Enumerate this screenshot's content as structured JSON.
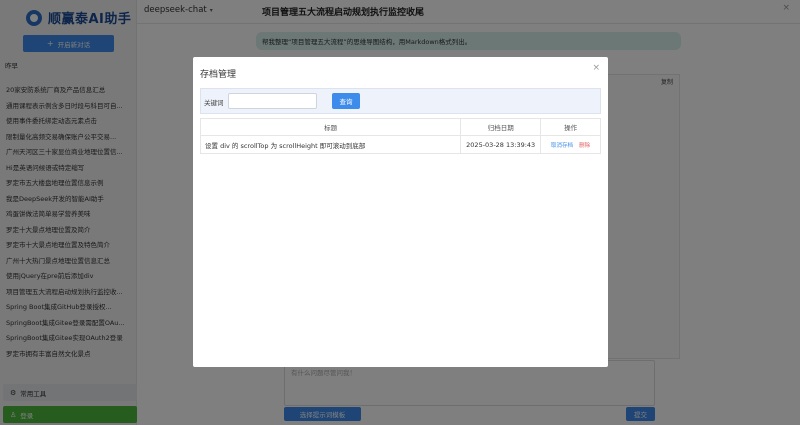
{
  "app": {
    "logo_text": "顺赢泰AI助手",
    "new_chat_label": "开启新对话",
    "recent_label": "昨早",
    "history": [
      "20家安防系统厂商及产品信息汇总",
      "通用课程表示例含多日时段与科目可自...",
      "使用事件委托绑定动态元素点击",
      "限制量化高频交易确保账户公平交易...",
      "广州天河区三十家显位商业地理位置信...",
      "Hi是英语问候语或特定缩写",
      "罗定市五大楼盘地理位置信息示例",
      "我是DeepSeek开发的智能AI助手",
      "鸡蛋饼做法简单易学营养美味",
      "罗定十大景点地理位置及简介",
      "罗定市十大景点地理位置及特色简介",
      "广州十大热门景点地理位置信息汇总",
      "使用jQuery在pre前后添加div",
      "项目管理五大流程启动规划执行监控收...",
      "Spring Boot集成GitHub登录授权...",
      "SpringBoot集成Gitee登录需配置OAu...",
      "SpringBoot集成Gitee实现OAuth2登录",
      "罗定市拥有丰富自然文化景点"
    ],
    "tools_label": "常用工具",
    "login_label": "登录",
    "model": "deepseek-chat",
    "chat_title": "项目管理五大流程启动规划执行监控收尾",
    "user_message": "帮我整理“项目管理五大流程”的思维导图结构，用Markdown格式列出。",
    "copy_label": "复制",
    "input_placeholder": "有什么问题尽管问我！",
    "prompt_template_label": "选择提示词模板",
    "submit_label": "提交"
  },
  "modal": {
    "title": "存档管理",
    "close_glyph": "×",
    "keyword_label": "关键词",
    "keyword_value": "",
    "query_label": "查询",
    "columns": [
      "标题",
      "归档日期",
      "操作"
    ],
    "rows": [
      {
        "title": "设置 div 的 scrollTop 为 scrollHeight 即可滚动到底部",
        "date": "2025-03-28 13:39:43",
        "unarchive_label": "取消存档",
        "delete_label": "删除"
      }
    ]
  },
  "colors": {
    "accent": "#3d8bea",
    "login": "#4fb83f",
    "danger": "#e35d5d",
    "bubble": "#d6f0ec"
  },
  "icons": {
    "new_chat": "plus-icon",
    "tools": "gear-icon",
    "login": "user-icon",
    "model_chevron": "chevron-down-icon",
    "modal_close": "close-icon"
  }
}
